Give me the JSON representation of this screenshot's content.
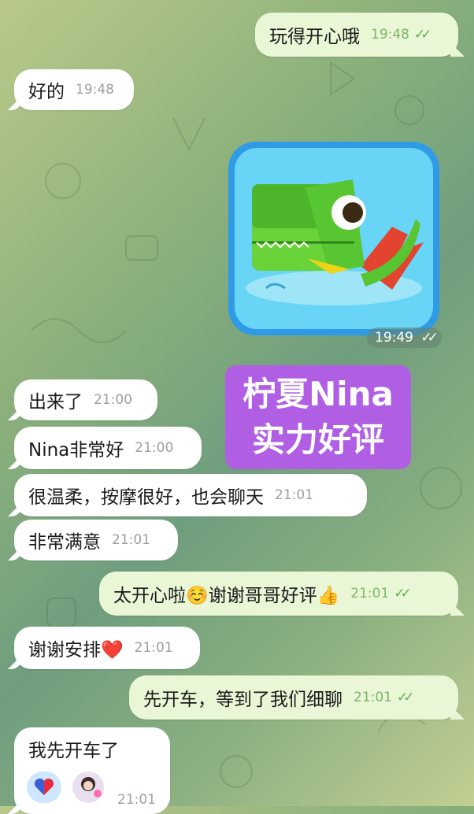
{
  "messages": [
    {
      "id": "m1",
      "side": "out",
      "text": "玩得开心哦",
      "time": "19:48",
      "read": true
    },
    {
      "id": "m2",
      "side": "in",
      "text": "好的",
      "time": "19:48"
    },
    {
      "id": "m3",
      "side": "in",
      "text": "出来了",
      "time": "21:00"
    },
    {
      "id": "m4",
      "side": "in",
      "text": "Nina非常好",
      "time": "21:00"
    },
    {
      "id": "m5",
      "side": "in",
      "text": "很温柔，按摩很好，也会聊天",
      "time": "21:01"
    },
    {
      "id": "m6",
      "side": "in",
      "text": "非常满意",
      "time": "21:01"
    },
    {
      "id": "m7",
      "side": "out",
      "text": "太开心啦☺️谢谢哥哥好评👍",
      "time": "21:01",
      "read": true
    },
    {
      "id": "m8",
      "side": "in",
      "text": "谢谢安排❤️",
      "time": "21:01"
    },
    {
      "id": "m9",
      "side": "out",
      "text": "先开车，等到了我们细聊",
      "time": "21:01",
      "read": true
    },
    {
      "id": "m10",
      "side": "in",
      "text": "我先开车了",
      "time": "21:01"
    }
  ],
  "sticker": {
    "time": "19:49",
    "icon": "dinosaur-sticker"
  },
  "promo": {
    "line1": "柠夏Nina",
    "line2": "实力好评"
  },
  "colors": {
    "incoming": "#ffffff",
    "outgoing": "#eaf7d6",
    "check": "#5fae56",
    "promo": "#b05ee3"
  }
}
